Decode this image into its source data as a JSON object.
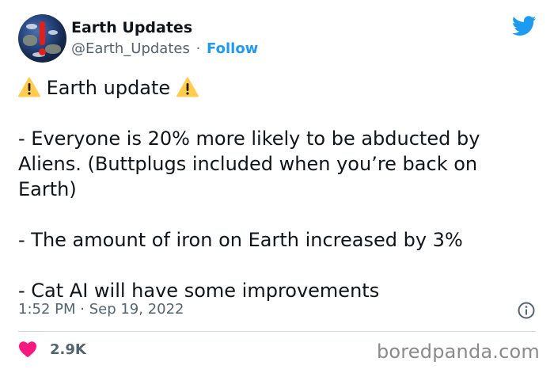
{
  "author": {
    "name": "Earth Updates",
    "handle": "@Earth_Updates",
    "separator": "·",
    "follow_label": "Follow",
    "avatar_icon": "earth-alert-avatar"
  },
  "tweet": {
    "headline": "Earth update",
    "lines": [
      "- Everyone is 20% more likely to be abducted by",
      "Aliens. (Buttplugs included when you’re back on",
      "Earth)",
      "- The amount of iron on Earth increased by 3%",
      "- Cat AI will have some improvements"
    ],
    "timestamp": "1:52 PM · Sep 19, 2022"
  },
  "engagement": {
    "likes": "2.9K"
  },
  "watermark": "boredpanda.com",
  "colors": {
    "accent": "#1d9bf0",
    "heart": "#f91880",
    "warning": "#ffcc4d",
    "muted": "#536471"
  }
}
